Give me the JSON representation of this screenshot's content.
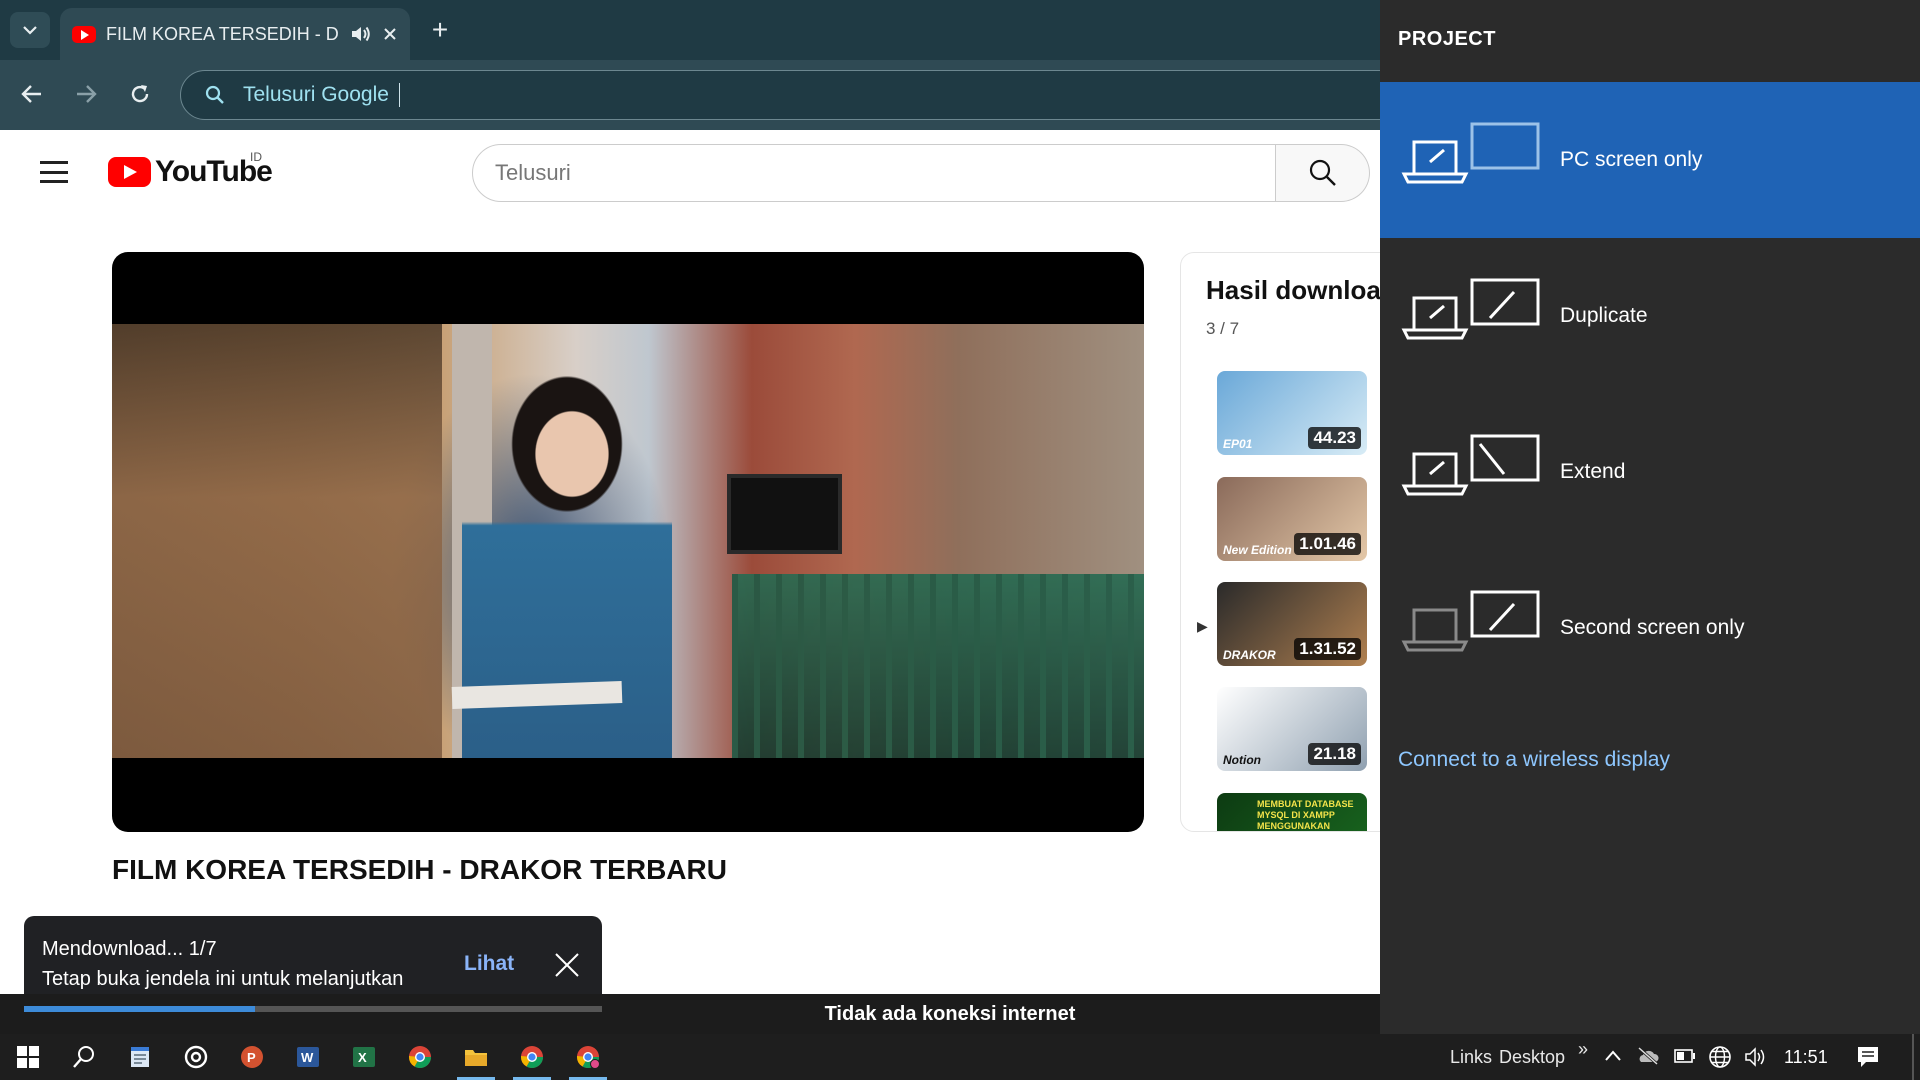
{
  "browser": {
    "tab_title": "FILM KOREA TERSEDIH - DRAKOR TERBARU",
    "new_tab_symbol": "+",
    "address_placeholder": "Telusuri Google"
  },
  "youtube": {
    "wordmark": "YouTube",
    "region": "ID",
    "search_placeholder": "Telusuri",
    "video_title": "FILM KOREA TERSEDIH - DRAKOR TERBARU",
    "playlist": {
      "title": "Hasil download",
      "position": "3 / 7",
      "items": [
        {
          "duration": "44.23",
          "tag": "EP01",
          "colors": [
            "#6aa8d8",
            "#d8ecf6"
          ]
        },
        {
          "duration": "1.01.46",
          "tag": "New Edition",
          "colors": [
            "#8a6a5a",
            "#e4c8a8"
          ]
        },
        {
          "duration": "1.31.52",
          "tag": "DRAKOR",
          "colors": [
            "#2a2a2a",
            "#b08050"
          ],
          "playing": true
        },
        {
          "duration": "21.18",
          "tag": "Notion",
          "colors": [
            "#ffffff",
            "#8fa0b0"
          ]
        },
        {
          "duration": "",
          "tag": "MEMBUAT DATABASE MYSQL DI XAMPP MENGGUNAKAN",
          "colors": [
            "#0d3b12",
            "#1a6a20"
          ]
        }
      ]
    }
  },
  "download_toast": {
    "line1": "Mendownload... 1/7",
    "line2": "Tetap buka jendela ini untuk melanjutkan",
    "action": "Lihat",
    "progress": 0.4
  },
  "offline_message": "Tidak ada koneksi internet",
  "project_panel": {
    "title": "PROJECT",
    "options": [
      {
        "label": "PC screen only",
        "selected": true
      },
      {
        "label": "Duplicate",
        "selected": false
      },
      {
        "label": "Extend",
        "selected": false
      },
      {
        "label": "Second screen only",
        "selected": false
      }
    ],
    "wireless_link": "Connect to a wireless display",
    "accent": "#1f63b5"
  },
  "taskbar": {
    "toolbar_links": "Links",
    "toolbar_desktop": "Desktop",
    "overflow": "»",
    "clock": "11:51"
  }
}
